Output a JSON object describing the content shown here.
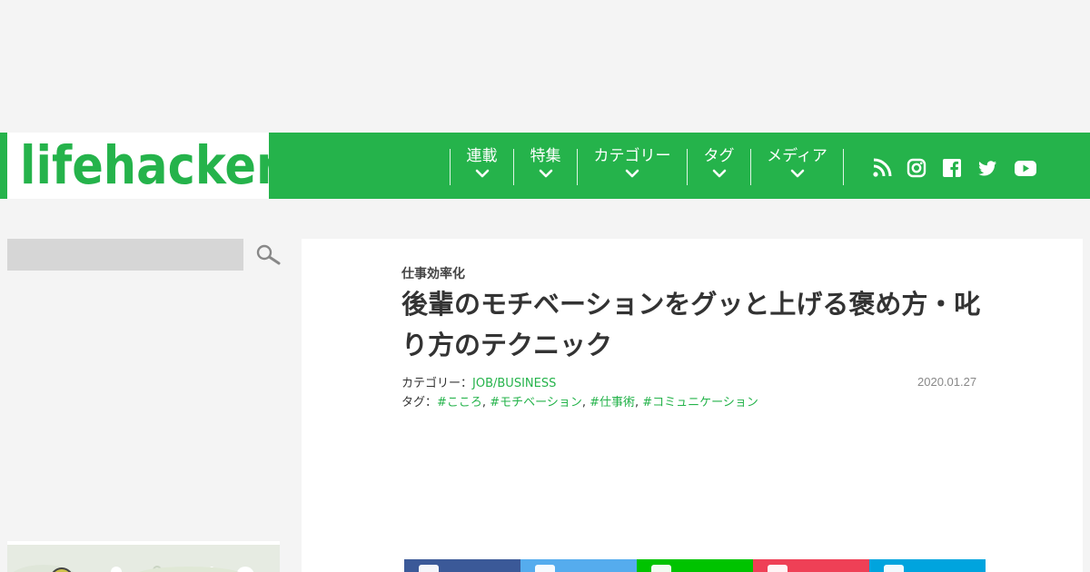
{
  "site": {
    "logo_text": "lifehacker",
    "brand_color": "#25b34b"
  },
  "nav": {
    "items": [
      {
        "label": "連載"
      },
      {
        "label": "特集"
      },
      {
        "label": "カテゴリー"
      },
      {
        "label": "タグ"
      },
      {
        "label": "メディア"
      }
    ],
    "social_icons": [
      "rss-icon",
      "instagram-icon",
      "facebook-icon",
      "twitter-icon",
      "youtube-icon"
    ]
  },
  "sidebar": {
    "search": {
      "placeholder": "",
      "value": ""
    },
    "search_icon": "magnifier-icon"
  },
  "article": {
    "category": "仕事効率化",
    "title": "後輩のモチベーションをグッと上げる褒め方・叱り方のテクニック",
    "category_prefix": "カテゴリー：",
    "category_link": "JOB/BUSINESS",
    "tags_prefix": "タグ：",
    "tags": [
      "#こころ",
      "#モチベーション",
      "#仕事術",
      "#コミュニケーション"
    ],
    "tag_separator": ", ",
    "date": "2020.01.27"
  },
  "share": {
    "buttons": [
      {
        "name": "facebook",
        "color": "#3b5998"
      },
      {
        "name": "twitter",
        "color": "#55acee"
      },
      {
        "name": "line",
        "color": "#00c300"
      },
      {
        "name": "pocket",
        "color": "#ef4056"
      },
      {
        "name": "hatena",
        "color": "#00a4de"
      }
    ]
  }
}
